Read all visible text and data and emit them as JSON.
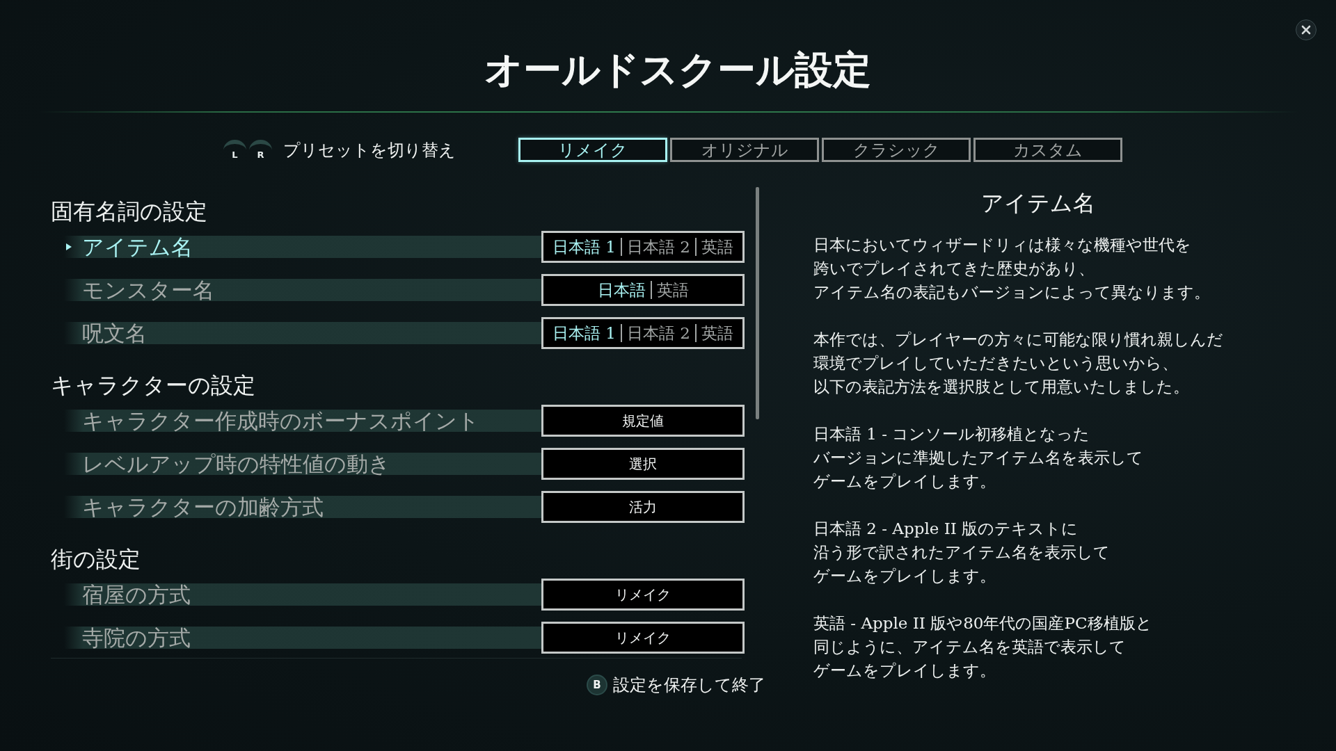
{
  "title": "オールドスクール設定",
  "preset_switch": {
    "keys": [
      "L",
      "R"
    ],
    "label": "プリセットを切り替え"
  },
  "tabs": [
    {
      "label": "リメイク",
      "selected": true
    },
    {
      "label": "オリジナル",
      "selected": false
    },
    {
      "label": "クラシック",
      "selected": false
    },
    {
      "label": "カスタム",
      "selected": false
    }
  ],
  "sections": [
    {
      "heading": "固有名詞の設定",
      "settings": [
        {
          "label": "アイテム名",
          "selected": true,
          "kind": "options",
          "options": [
            {
              "label": "日本語 1",
              "selected": true
            },
            {
              "label": "日本語 2",
              "selected": false
            },
            {
              "label": "英語",
              "selected": false
            }
          ]
        },
        {
          "label": "モンスター名",
          "selected": false,
          "kind": "options",
          "options": [
            {
              "label": "日本語",
              "selected": true
            },
            {
              "label": "英語",
              "selected": false
            }
          ]
        },
        {
          "label": "呪文名",
          "selected": false,
          "kind": "options",
          "options": [
            {
              "label": "日本語 1",
              "selected": true
            },
            {
              "label": "日本語 2",
              "selected": false
            },
            {
              "label": "英語",
              "selected": false
            }
          ]
        }
      ]
    },
    {
      "heading": "キャラクターの設定",
      "settings": [
        {
          "label": "キャラクター作成時のボーナスポイント",
          "selected": false,
          "kind": "value",
          "value": "規定値"
        },
        {
          "label": "レベルアップ時の特性値の動き",
          "selected": false,
          "kind": "value",
          "value": "選択"
        },
        {
          "label": "キャラクターの加齢方式",
          "selected": false,
          "kind": "value",
          "value": "活力"
        }
      ]
    },
    {
      "heading": "街の設定",
      "settings": [
        {
          "label": "宿屋の方式",
          "selected": false,
          "kind": "value",
          "value": "リメイク"
        },
        {
          "label": "寺院の方式",
          "selected": false,
          "kind": "value",
          "value": "リメイク"
        }
      ]
    }
  ],
  "description": {
    "title": "アイテム名",
    "paragraphs": [
      {
        "lines": [
          "日本においてウィザードリィは様々な機種や世代を",
          "跨いでプレイされてきた歴史があり、",
          "アイテム名の表記もバージョンによって異なります。"
        ]
      },
      {
        "lines": [
          "本作では、プレイヤーの方々に可能な限り慣れ親しんだ",
          "環境でプレイしていただきたいという思いから、",
          "以下の表記方法を選択肢として用意いたしました。"
        ]
      },
      {
        "lines": [
          "日本語 1 - コンソール初移植となった",
          "バージョンに準拠したアイテム名を表示して",
          "ゲームをプレイします。"
        ]
      },
      {
        "lines": [
          "日本語 2 - Apple II 版のテキストに",
          "沿う形で訳されたアイテム名を表示して",
          "ゲームをプレイします。"
        ]
      },
      {
        "lines": [
          "英語 - Apple II 版や80年代の国産PC移植版と",
          "同じように、アイテム名を英語で表示して",
          "ゲームをプレイします。"
        ]
      }
    ]
  },
  "footer": {
    "key": "B",
    "label": "設定を保存して終了"
  }
}
